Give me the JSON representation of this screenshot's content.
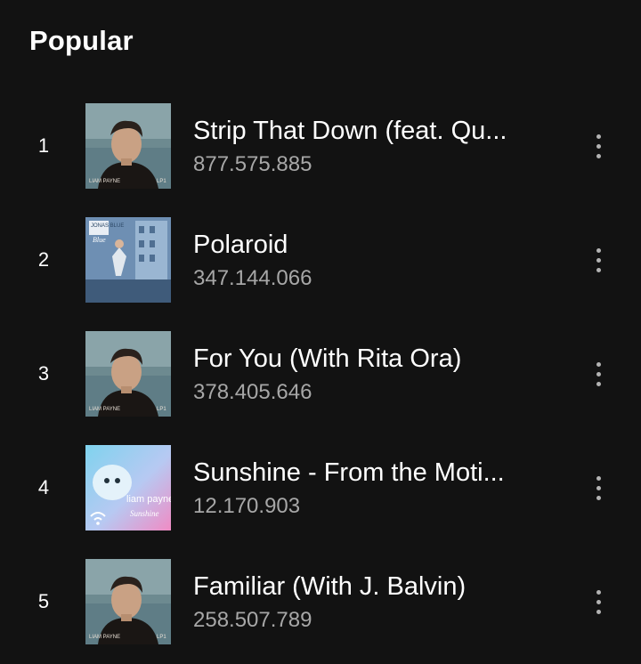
{
  "section": {
    "title": "Popular"
  },
  "colors": {
    "background": "#121212",
    "primary_text": "#ffffff",
    "secondary_text": "#a7a7a7",
    "icon": "#b3b3b3"
  },
  "tracks": [
    {
      "rank": "1",
      "title": "Strip That Down (feat. Qu...",
      "plays": "877.575.885",
      "art": "lp1-cover",
      "art_caption": "LIAM PAYNE",
      "art_mark": "LP1"
    },
    {
      "rank": "2",
      "title": "Polaroid",
      "plays": "347.144.066",
      "art": "polaroid-cover",
      "art_caption": "JONAS BLUE",
      "art_mark": "Blue"
    },
    {
      "rank": "3",
      "title": "For You (With Rita Ora)",
      "plays": "378.405.646",
      "art": "lp1-cover",
      "art_caption": "LIAM PAYNE",
      "art_mark": "LP1"
    },
    {
      "rank": "4",
      "title": "Sunshine - From the Moti...",
      "plays": "12.170.903",
      "art": "sunshine-cover",
      "art_caption": "liam payne",
      "art_mark": "Sunshine"
    },
    {
      "rank": "5",
      "title": "Familiar (With J. Balvin)",
      "plays": "258.507.789",
      "art": "lp1-cover",
      "art_caption": "LIAM PAYNE",
      "art_mark": "LP1"
    }
  ],
  "icons": {
    "more": "more-options-icon"
  }
}
